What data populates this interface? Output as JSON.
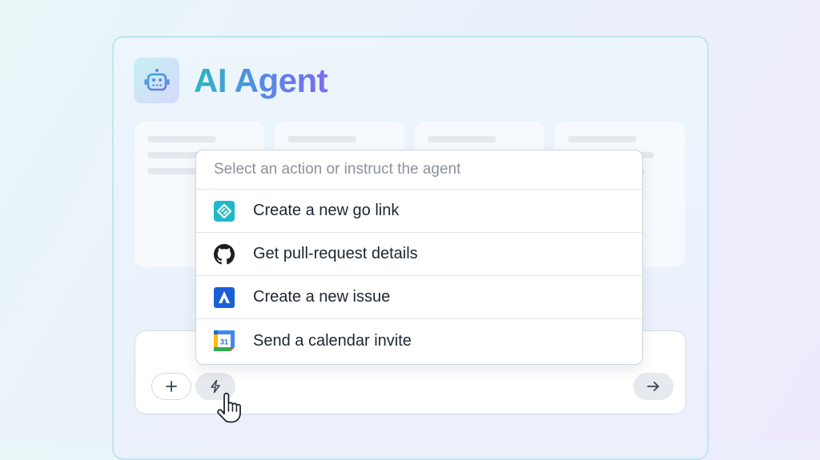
{
  "app": {
    "title": "AI Agent",
    "logo_icon": "robot-icon"
  },
  "dropdown": {
    "placeholder": "Select an action or instruct the agent",
    "items": [
      {
        "label": "Create a new go link",
        "icon": "go-link-icon",
        "color": "#1fb8c8"
      },
      {
        "label": "Get pull-request details",
        "icon": "github-icon",
        "color": "#1b1f24"
      },
      {
        "label": "Create a new issue",
        "icon": "jira-atlassian-icon",
        "color": "#1a5fd6"
      },
      {
        "label": "Send a calendar invite",
        "icon": "google-calendar-icon",
        "color": "#4285f4",
        "icon_text": "31"
      }
    ]
  },
  "composer": {
    "add_icon": "plus-icon",
    "actions_icon": "lightning-bolt-icon",
    "send_icon": "arrow-right-icon",
    "cursor_icon": "hand-pointer-cursor-icon"
  },
  "colors": {
    "accent_start": "#2bb7c4",
    "accent_end": "#7b6cf0",
    "panel_border": "#bfe6ee"
  }
}
